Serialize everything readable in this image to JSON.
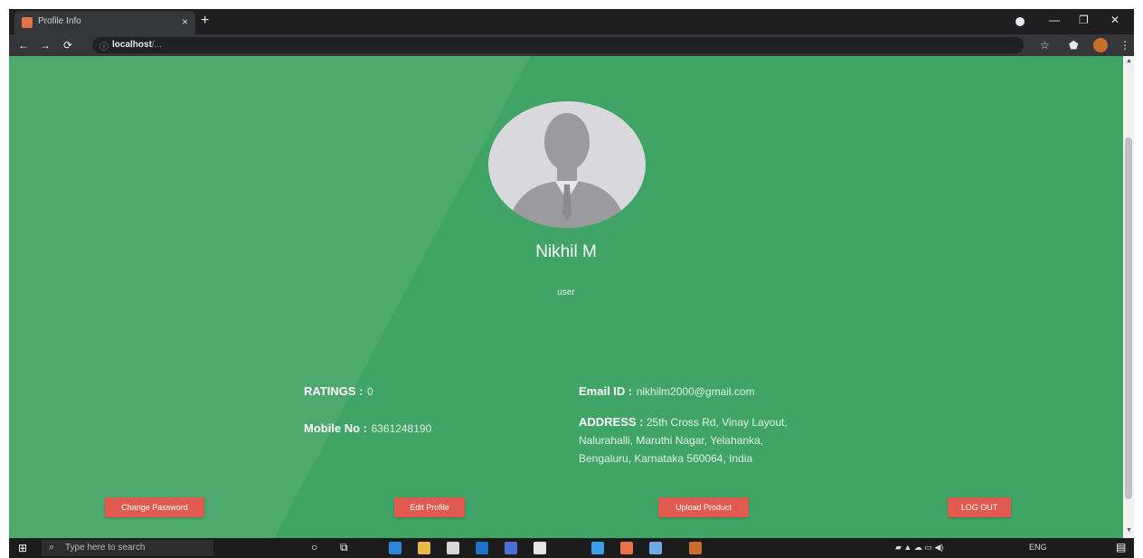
{
  "browser": {
    "tab_title": "Profile Info",
    "tab_close": "×",
    "new_tab": "+",
    "url_host": "localhost",
    "url_path": "/...",
    "nav_back": "←",
    "nav_forward": "→",
    "nav_reload": "⟳",
    "window_minimize": "—",
    "window_restore": "❐",
    "window_close": "✕"
  },
  "profile": {
    "name": "Nikhil M",
    "role": "user",
    "ratings_label": "RATINGS :",
    "ratings_value": "0",
    "email_label": "Email ID :",
    "email_value": "nikhilm2000@gmail.com",
    "mobile_label": "Mobile No :",
    "mobile_value": "6361248190",
    "address_label": "ADDRESS :",
    "address_line1": "25th Cross Rd, Vinay Layout,",
    "address_line2": "Nalurahalli, Maruthi Nagar, Yelahanka,",
    "address_line3": "Bengaluru, Karnataka 560064, India"
  },
  "buttons": {
    "change_password": "Change Password",
    "edit_profile": "Edit Profile",
    "upload_product": "Upload Product",
    "logout": "LOG OUT"
  },
  "taskbar": {
    "search_placeholder": "Type here to search",
    "tray_lang": "ENG"
  },
  "colors": {
    "page_green_light": "#4ea96f",
    "page_green_dark": "#3fa466",
    "button_red": "#e05a4f"
  },
  "icons": {
    "start": "windows-start-icon",
    "search": "search-icon",
    "avatar": "default-user-avatar"
  }
}
